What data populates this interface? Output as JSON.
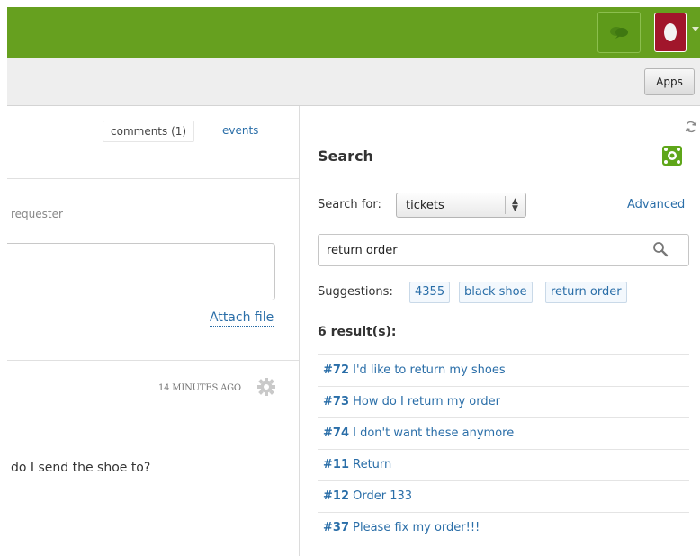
{
  "topbar": {
    "colors": {
      "bar": "#66a01f",
      "avatar": "#a1162b"
    },
    "chat_icon": "chat-bubbles-icon",
    "avatar_icon": "user-avatar-icon"
  },
  "subbar": {
    "apps_label": "Apps"
  },
  "ticket": {
    "tabs": {
      "comments": "comments (1)",
      "events": "events"
    },
    "requester_label": "requester",
    "attach_label": "Attach file",
    "comment": {
      "time": "14 MINUTES AGO",
      "text": "do I send the shoe to?"
    }
  },
  "search": {
    "title": "Search",
    "search_for_label": "Search for:",
    "search_for_value": "tickets",
    "advanced_label": "Advanced",
    "query": "return order",
    "suggestions_label": "Suggestions:",
    "suggestions": [
      "4355",
      "black shoe",
      "return order"
    ],
    "results_heading": "6 result(s):",
    "results": [
      {
        "id": "#72",
        "title": "I'd like to return my shoes"
      },
      {
        "id": "#73",
        "title": "How do I return my order"
      },
      {
        "id": "#74",
        "title": "I don't want these anymore"
      },
      {
        "id": "#11",
        "title": "Return"
      },
      {
        "id": "#12",
        "title": "Order 133"
      },
      {
        "id": "#37",
        "title": "Please fix my order!!!"
      }
    ]
  },
  "colors": {
    "link": "#2a6ea8",
    "text": "#333333"
  }
}
